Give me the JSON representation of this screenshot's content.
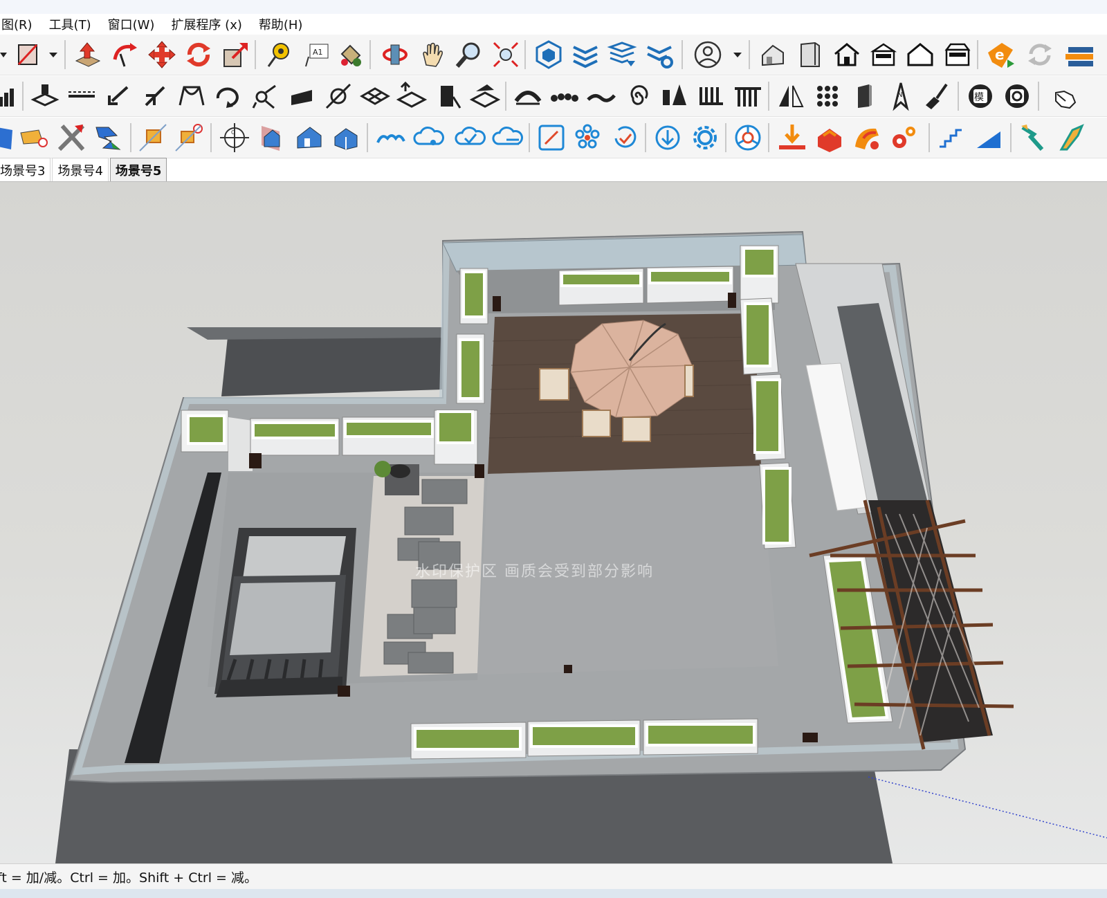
{
  "menubar": {
    "items": [
      "图(R)",
      "工具(T)",
      "窗口(W)",
      "扩展程序 (x)",
      "帮助(H)"
    ]
  },
  "toolbars": {
    "row1": [
      "dropdown-arrow-icon",
      "rectangle-tool-icon",
      "dropdown-arrow-icon",
      "push-pull-icon",
      "follow-me-icon",
      "move-icon",
      "rotate-icon",
      "scale-icon",
      "tape-measure-icon",
      "text-tool-icon",
      "paint-bucket-icon",
      "orbit-icon",
      "pan-hand-icon",
      "zoom-icon",
      "zoom-extents-icon",
      "warehouse-cube-icon",
      "layers-stack-icon",
      "layers-arrow-icon",
      "layers-gear-icon",
      "user-account-icon",
      "dropdown-arrow-icon",
      "house-iso-icon",
      "door-icon",
      "home-outline-icon",
      "home-front-icon",
      "home-outline-2-icon",
      "home-side-icon",
      "extension-e-icon",
      "refresh-icon",
      "storage-icon"
    ],
    "row2": [
      "bar-chart-icon",
      "draw-tool-icon",
      "line-tool-icon",
      "arrow-down-left-icon",
      "arrows-split-icon",
      "arc-tool-icon",
      "rotate-curve-icon",
      "node-tool-icon",
      "slab-icon",
      "circle-line-icon",
      "tiles-icon",
      "tiles-arrow-icon",
      "door-shape-icon",
      "tiles-rotate-icon",
      "arch-icon",
      "dots-row-icon",
      "wave-icon",
      "spiral-icon",
      "bars-shape-icon",
      "comb-icon",
      "columns-icon",
      "mirror-icon",
      "grid-dots-icon",
      "door-panel-icon",
      "north-arrow-icon",
      "brush-icon",
      "model-badge-icon",
      "badge-cycle-icon",
      "hand-pointer-icon"
    ],
    "row3": [
      "shape-icon",
      "eraser-icon",
      "cross-icon",
      "lightning-icon",
      "section-box-icon",
      "section-remove-icon",
      "section-plane-icon",
      "house-section-icon",
      "house-blue-icon",
      "house-cube-icon",
      "cloud-wave-icon",
      "cloud-nodes-icon",
      "cloud-check-icon",
      "cloud-lines-icon",
      "resize-icon",
      "flower-dots-icon",
      "refresh-check-icon",
      "download-circle-icon",
      "settings-gear-icon",
      "chrome-icon",
      "import-icon",
      "export-icon",
      "render-icon",
      "gears-icon",
      "stairs-icon",
      "ramp-icon",
      "paint-tool-icon",
      "paint-tool-2-icon"
    ]
  },
  "scene_tabs": [
    "场景号3",
    "场景号4",
    "场景号5"
  ],
  "active_scene": "场景号5",
  "viewport": {
    "watermark": "水印保护区   画质会受到部分影响"
  },
  "statusbar": {
    "text": "ft = 加/减。Ctrl = 加。Shift + Ctrl = 减。"
  },
  "colors": {
    "toolbar_bg": "#f5f5f5",
    "viewport_bg": "#dcdcd9",
    "deck": "#5a4a40",
    "paving": "#a9acae",
    "planter_grass": "#7ea047",
    "glass_rail": "#b9c7cf",
    "pergola_wood": "#6b3d24",
    "umbrella": "#dbb39e"
  }
}
